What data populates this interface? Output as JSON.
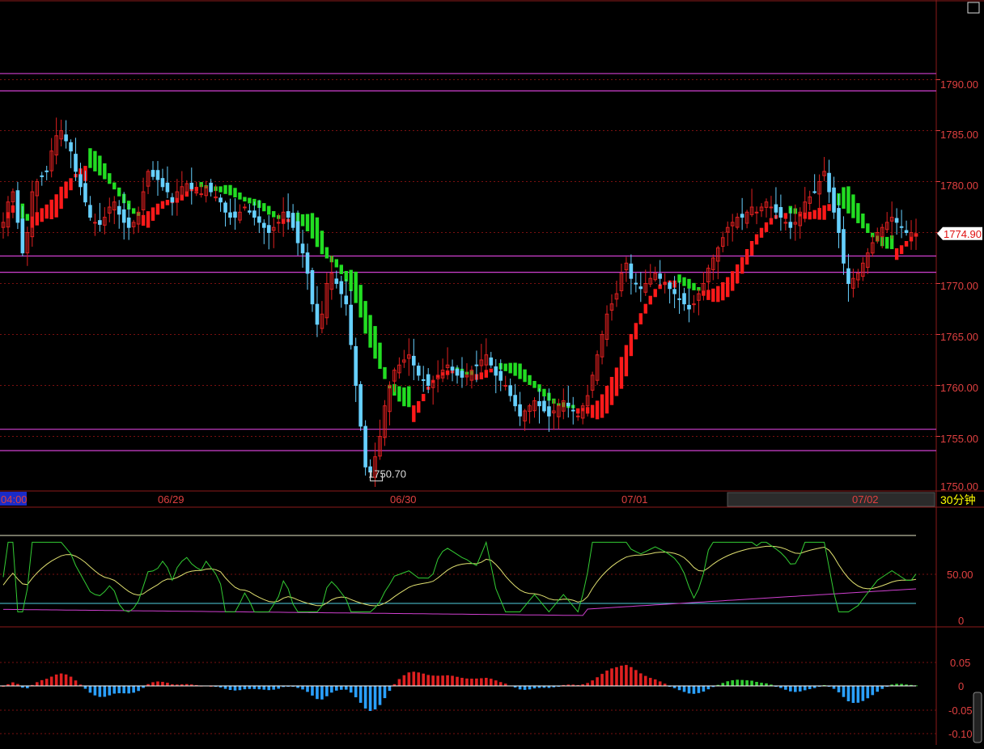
{
  "colors": {
    "background": "#000000",
    "frame": "#8b1a1a",
    "grid": "#7a1010",
    "axis_text": "#e04040",
    "up": "#e02020",
    "down": "#66d0ff",
    "ma_up": "#ff1a1a",
    "ma_down": "#22dd22",
    "support_line": "#d040d0",
    "price_tag": "#ffffff",
    "period_label": "#ffff00"
  },
  "header": {
    "window_button": "□"
  },
  "price_panel": {
    "y_axis": {
      "ticks": [
        "1790.00",
        "1785.00",
        "1780.00",
        "1775.00",
        "1770.00",
        "1765.00",
        "1760.00",
        "1755.00",
        "1750.00"
      ],
      "min": 1749.8,
      "max": 1797.5
    },
    "last_price_label": "1774.90",
    "last_price": 1774.9,
    "low_label": "1750.70",
    "low_price": 1750.7,
    "horizontal_levels": [
      1790.6,
      1788.9,
      1772.7,
      1771.1,
      1755.7,
      1753.6
    ]
  },
  "time_axis": {
    "labels": [
      {
        "text": "04:00",
        "highlighted": true
      },
      {
        "text": "06/29",
        "highlighted": false
      },
      {
        "text": "06/30",
        "highlighted": false
      },
      {
        "text": "07/01",
        "highlighted": false
      },
      {
        "text": "07/02",
        "highlighted": false
      }
    ],
    "period": "30分钟"
  },
  "indicator_panel": {
    "ticks": [
      "50.00",
      "0"
    ],
    "upper_band": 100,
    "lower_band": 20
  },
  "macd_panel": {
    "ticks": [
      "0.05",
      "0",
      "-0.05",
      "-0.10"
    ]
  },
  "chart_data": {
    "type": "candlestick",
    "price_range": [
      1749.8,
      1797.5
    ],
    "closes": [
      1776.0,
      1778.0,
      1779.0,
      1776.0,
      1773.0,
      1775.0,
      1779.0,
      1780.0,
      1780.5,
      1781.0,
      1783.0,
      1784.5,
      1785.0,
      1784.0,
      1783.0,
      1781.0,
      1779.5,
      1778.0,
      1776.5,
      1776.0,
      1775.8,
      1776.5,
      1777.5,
      1778.0,
      1776.8,
      1776.0,
      1775.5,
      1776.0,
      1777.0,
      1779.0,
      1781.0,
      1780.5,
      1780.2,
      1779.5,
      1779.0,
      1778.0,
      1779.0,
      1779.5,
      1779.8,
      1779.3,
      1779.0,
      1778.8,
      1779.5,
      1779.0,
      1778.5,
      1778.0,
      1777.0,
      1776.5,
      1776.5,
      1777.0,
      1777.5,
      1777.0,
      1776.5,
      1776.0,
      1775.5,
      1775.0,
      1775.5,
      1776.0,
      1777.0,
      1776.5,
      1775.5,
      1774.0,
      1773.0,
      1771.0,
      1768.0,
      1766.0,
      1767.0,
      1770.0,
      1771.0,
      1770.0,
      1769.0,
      1768.0,
      1764.0,
      1760.0,
      1756.0,
      1752.0,
      1751.5,
      1753.0,
      1755.0,
      1758.0,
      1760.0,
      1761.5,
      1762.0,
      1762.5,
      1763.0,
      1762.0,
      1761.0,
      1760.5,
      1760.0,
      1760.5,
      1761.0,
      1761.5,
      1762.0,
      1761.5,
      1761.0,
      1760.8,
      1761.0,
      1761.5,
      1762.0,
      1762.5,
      1763.0,
      1762.0,
      1761.0,
      1760.5,
      1760.0,
      1759.0,
      1758.0,
      1757.0,
      1757.5,
      1758.0,
      1758.5,
      1758.0,
      1757.5,
      1757.0,
      1757.5,
      1758.0,
      1758.5,
      1758.0,
      1757.5,
      1757.0,
      1758.0,
      1759.0,
      1761.0,
      1763.0,
      1765.0,
      1767.0,
      1768.0,
      1769.0,
      1771.0,
      1772.0,
      1770.5,
      1770.0,
      1769.5,
      1770.0,
      1770.5,
      1771.0,
      1770.5,
      1770.0,
      1769.5,
      1769.0,
      1768.5,
      1768.0,
      1767.5,
      1768.0,
      1769.0,
      1770.0,
      1771.5,
      1772.5,
      1773.5,
      1774.5,
      1775.5,
      1776.0,
      1776.5,
      1776.5,
      1777.0,
      1777.5,
      1777.0,
      1777.5,
      1778.0,
      1777.5,
      1777.0,
      1776.5,
      1776.0,
      1775.5,
      1776.0,
      1777.0,
      1778.0,
      1778.5,
      1779.0,
      1780.0,
      1781.0,
      1779.0,
      1777.0,
      1775.0,
      1772.0,
      1770.0,
      1770.5,
      1771.0,
      1772.0,
      1773.0,
      1774.0,
      1775.0,
      1775.5,
      1776.0,
      1776.5,
      1776.0,
      1775.5,
      1775.0,
      1775.0,
      1774.9
    ],
    "series": [
      {
        "name": "MA",
        "values_source": "computed moving average of closes"
      }
    ],
    "macd_range": [
      -0.12,
      0.09
    ],
    "indicator_range": [
      0,
      100
    ]
  }
}
